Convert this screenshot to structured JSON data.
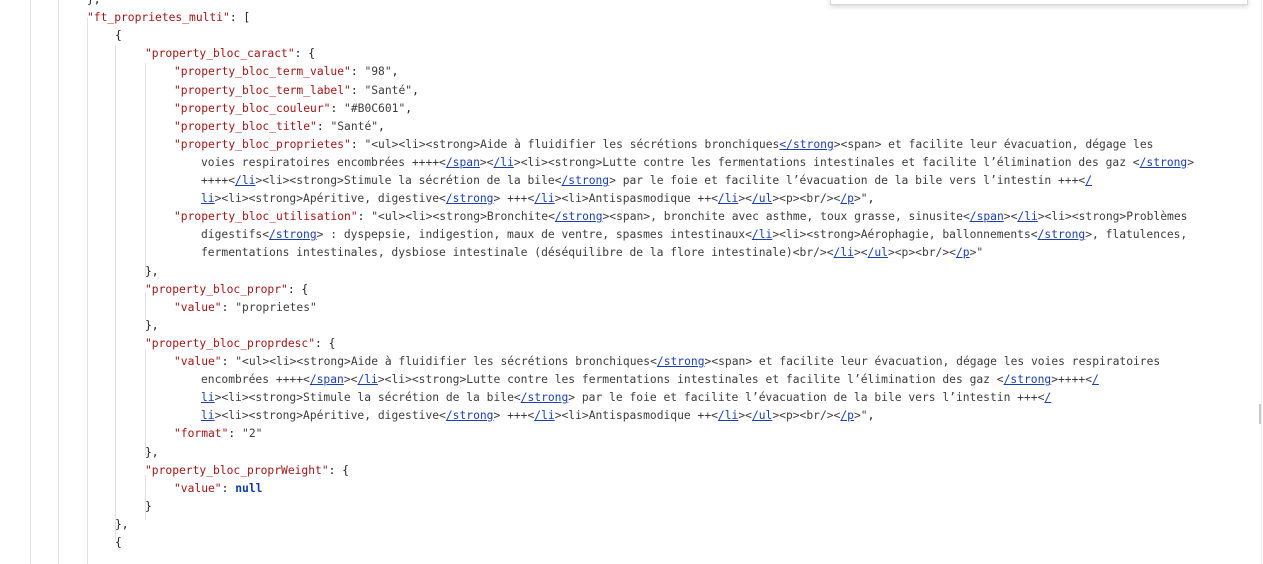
{
  "json_viewer": {
    "lines": [
      {
        "indent": 2,
        "segments": [
          {
            "t": "p",
            "v": "},"
          }
        ]
      },
      {
        "indent": 2,
        "segments": [
          {
            "t": "k",
            "v": "\"ft_proprietes_multi\""
          },
          {
            "t": "p",
            "v": ": ["
          }
        ]
      },
      {
        "indent": 3,
        "segments": [
          {
            "t": "p",
            "v": "{"
          }
        ]
      },
      {
        "indent": 4,
        "segments": [
          {
            "t": "k",
            "v": "\"property_bloc_caract\""
          },
          {
            "t": "p",
            "v": ": {"
          }
        ]
      },
      {
        "indent": 5,
        "segments": [
          {
            "t": "k",
            "v": "\"property_bloc_term_value\""
          },
          {
            "t": "p",
            "v": ": "
          },
          {
            "t": "s",
            "v": "\"98\""
          },
          {
            "t": "p",
            "v": ","
          }
        ]
      },
      {
        "indent": 5,
        "segments": [
          {
            "t": "k",
            "v": "\"property_bloc_term_label\""
          },
          {
            "t": "p",
            "v": ": "
          },
          {
            "t": "s",
            "v": "\"Santé\""
          },
          {
            "t": "p",
            "v": ","
          }
        ]
      },
      {
        "indent": 5,
        "segments": [
          {
            "t": "k",
            "v": "\"property_bloc_couleur\""
          },
          {
            "t": "p",
            "v": ": "
          },
          {
            "t": "s",
            "v": "\"#B0C601\""
          },
          {
            "t": "p",
            "v": ","
          }
        ]
      },
      {
        "indent": 5,
        "segments": [
          {
            "t": "k",
            "v": "\"property_bloc_title\""
          },
          {
            "t": "p",
            "v": ": "
          },
          {
            "t": "s",
            "v": "\"Santé\""
          },
          {
            "t": "p",
            "v": ","
          }
        ]
      },
      {
        "indent": 5,
        "segments": [
          {
            "t": "k",
            "v": "\"property_bloc_proprietes\""
          },
          {
            "t": "p",
            "v": ": "
          },
          {
            "t": "s",
            "v": "\"<ul><li><strong>Aide à fluidifier les sécrétions bronchiques"
          },
          {
            "t": "u",
            "v": "</strong"
          },
          {
            "t": "s",
            "v": "><span> et facilite leur évacuation, dégage les"
          }
        ]
      },
      {
        "indent": 6,
        "segments": [
          {
            "t": "s",
            "v": "voies respiratoires encombrées ++++<"
          },
          {
            "t": "u",
            "v": "/span"
          },
          {
            "t": "s",
            "v": "><"
          },
          {
            "t": "u",
            "v": "/li"
          },
          {
            "t": "s",
            "v": "><li><strong>Lutte contre les fermentations intestinales et facilite l’élimination des gaz <"
          },
          {
            "t": "u",
            "v": "/strong"
          },
          {
            "t": "s",
            "v": ">"
          }
        ]
      },
      {
        "indent": 6,
        "segments": [
          {
            "t": "s",
            "v": "++++<"
          },
          {
            "t": "u",
            "v": "/li"
          },
          {
            "t": "s",
            "v": "><li><strong>Stimule la sécrétion de la bile<"
          },
          {
            "t": "u",
            "v": "/strong"
          },
          {
            "t": "s",
            "v": "> par le foie et facilite l’évacuation de la bile vers l’intestin +++<"
          },
          {
            "t": "u",
            "v": "/"
          }
        ]
      },
      {
        "indent": 6,
        "segments": [
          {
            "t": "u",
            "v": "li"
          },
          {
            "t": "s",
            "v": "><li><strong>Apéritive, digestive<"
          },
          {
            "t": "u",
            "v": "/strong"
          },
          {
            "t": "s",
            "v": "> +++<"
          },
          {
            "t": "u",
            "v": "/li"
          },
          {
            "t": "s",
            "v": "><li>Antispasmodique ++<"
          },
          {
            "t": "u",
            "v": "/li"
          },
          {
            "t": "s",
            "v": "><"
          },
          {
            "t": "u",
            "v": "/ul"
          },
          {
            "t": "s",
            "v": "><p><br/><"
          },
          {
            "t": "u",
            "v": "/p"
          },
          {
            "t": "s",
            "v": ">\""
          },
          {
            "t": "p",
            "v": ","
          }
        ]
      },
      {
        "indent": 5,
        "segments": [
          {
            "t": "k",
            "v": "\"property_bloc_utilisation\""
          },
          {
            "t": "p",
            "v": ": "
          },
          {
            "t": "s",
            "v": "\"<ul><li><strong>Bronchite<"
          },
          {
            "t": "u",
            "v": "/strong"
          },
          {
            "t": "s",
            "v": "><span>, bronchite avec asthme, toux grasse, sinusite<"
          },
          {
            "t": "u",
            "v": "/span"
          },
          {
            "t": "s",
            "v": "><"
          },
          {
            "t": "u",
            "v": "/li"
          },
          {
            "t": "s",
            "v": "><li><strong>Problèmes"
          }
        ]
      },
      {
        "indent": 6,
        "segments": [
          {
            "t": "s",
            "v": "digestifs<"
          },
          {
            "t": "u",
            "v": "/strong"
          },
          {
            "t": "s",
            "v": "> : dyspepsie, indigestion, maux de ventre, spasmes intestinaux<"
          },
          {
            "t": "u",
            "v": "/li"
          },
          {
            "t": "s",
            "v": "><li><strong>Aérophagie, ballonnements<"
          },
          {
            "t": "u",
            "v": "/strong"
          },
          {
            "t": "s",
            "v": ">, flatulences,"
          }
        ]
      },
      {
        "indent": 6,
        "segments": [
          {
            "t": "s",
            "v": "fermentations intestinales, dysbiose intestinale (déséquilibre de la flore intestinale)<br/><"
          },
          {
            "t": "u",
            "v": "/li"
          },
          {
            "t": "s",
            "v": "><"
          },
          {
            "t": "u",
            "v": "/ul"
          },
          {
            "t": "s",
            "v": "><p><br/><"
          },
          {
            "t": "u",
            "v": "/p"
          },
          {
            "t": "s",
            "v": ">\""
          }
        ]
      },
      {
        "indent": 4,
        "segments": [
          {
            "t": "p",
            "v": "},"
          }
        ]
      },
      {
        "indent": 4,
        "segments": [
          {
            "t": "k",
            "v": "\"property_bloc_propr\""
          },
          {
            "t": "p",
            "v": ": {"
          }
        ]
      },
      {
        "indent": 5,
        "segments": [
          {
            "t": "k",
            "v": "\"value\""
          },
          {
            "t": "p",
            "v": ": "
          },
          {
            "t": "s",
            "v": "\"proprietes\""
          }
        ]
      },
      {
        "indent": 4,
        "segments": [
          {
            "t": "p",
            "v": "},"
          }
        ]
      },
      {
        "indent": 4,
        "segments": [
          {
            "t": "k",
            "v": "\"property_bloc_proprdesc\""
          },
          {
            "t": "p",
            "v": ": {"
          }
        ]
      },
      {
        "indent": 5,
        "segments": [
          {
            "t": "k",
            "v": "\"value\""
          },
          {
            "t": "p",
            "v": ": "
          },
          {
            "t": "s",
            "v": "\"<ul><li><strong>Aide à fluidifier les sécrétions bronchiques<"
          },
          {
            "t": "u",
            "v": "/strong"
          },
          {
            "t": "s",
            "v": "><span> et facilite leur évacuation, dégage les voies respiratoires"
          }
        ]
      },
      {
        "indent": 6,
        "segments": [
          {
            "t": "s",
            "v": "encombrées ++++<"
          },
          {
            "t": "u",
            "v": "/span"
          },
          {
            "t": "s",
            "v": "><"
          },
          {
            "t": "u",
            "v": "/li"
          },
          {
            "t": "s",
            "v": "><li><strong>Lutte contre les fermentations intestinales et facilite l’élimination des gaz <"
          },
          {
            "t": "u",
            "v": "/strong"
          },
          {
            "t": "s",
            "v": ">++++<"
          },
          {
            "t": "u",
            "v": "/"
          }
        ]
      },
      {
        "indent": 6,
        "segments": [
          {
            "t": "u",
            "v": "li"
          },
          {
            "t": "s",
            "v": "><li><strong>Stimule la sécrétion de la bile<"
          },
          {
            "t": "u",
            "v": "/strong"
          },
          {
            "t": "s",
            "v": "> par le foie et facilite l’évacuation de la bile vers l’intestin +++<"
          },
          {
            "t": "u",
            "v": "/"
          }
        ]
      },
      {
        "indent": 6,
        "segments": [
          {
            "t": "u",
            "v": "li"
          },
          {
            "t": "s",
            "v": "><li><strong>Apéritive, digestive<"
          },
          {
            "t": "u",
            "v": "/strong"
          },
          {
            "t": "s",
            "v": "> +++<"
          },
          {
            "t": "u",
            "v": "/li"
          },
          {
            "t": "s",
            "v": "><li>Antispasmodique ++<"
          },
          {
            "t": "u",
            "v": "/li"
          },
          {
            "t": "s",
            "v": "><"
          },
          {
            "t": "u",
            "v": "/ul"
          },
          {
            "t": "s",
            "v": "><p><br/><"
          },
          {
            "t": "u",
            "v": "/p"
          },
          {
            "t": "s",
            "v": ">\""
          },
          {
            "t": "p",
            "v": ","
          }
        ]
      },
      {
        "indent": 5,
        "segments": [
          {
            "t": "k",
            "v": "\"format\""
          },
          {
            "t": "p",
            "v": ": "
          },
          {
            "t": "s",
            "v": "\"2\""
          }
        ]
      },
      {
        "indent": 4,
        "segments": [
          {
            "t": "p",
            "v": "},"
          }
        ]
      },
      {
        "indent": 4,
        "segments": [
          {
            "t": "k",
            "v": "\"property_bloc_proprWeight\""
          },
          {
            "t": "p",
            "v": ": {"
          }
        ]
      },
      {
        "indent": 5,
        "segments": [
          {
            "t": "k",
            "v": "\"value\""
          },
          {
            "t": "p",
            "v": ": "
          },
          {
            "t": "n",
            "v": "null"
          }
        ]
      },
      {
        "indent": 4,
        "segments": [
          {
            "t": "p",
            "v": "}"
          }
        ]
      },
      {
        "indent": 3,
        "segments": [
          {
            "t": "p",
            "v": "},"
          }
        ]
      },
      {
        "indent": 3,
        "segments": [
          {
            "t": "p",
            "v": "{"
          }
        ]
      }
    ]
  }
}
